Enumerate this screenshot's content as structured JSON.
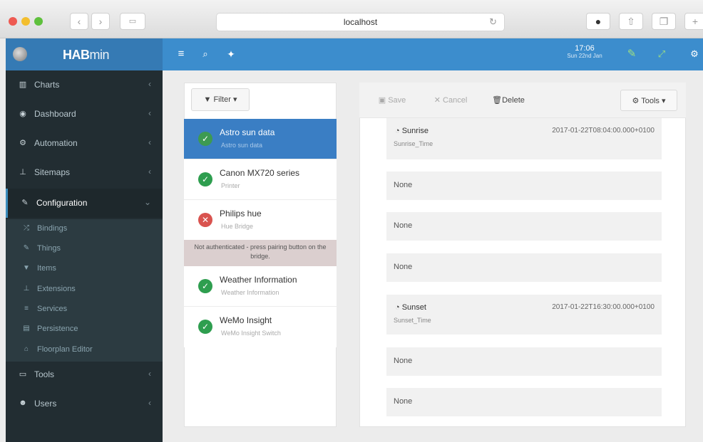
{
  "browser": {
    "url": "localhost"
  },
  "app": {
    "brand_bold": "HAB",
    "brand_light": "min",
    "time": "17:06",
    "date": "Sun 22nd Jan"
  },
  "sidebar": {
    "items": [
      {
        "label": "Charts",
        "icon": "bar-chart-icon"
      },
      {
        "label": "Dashboard",
        "icon": "dashboard-icon"
      },
      {
        "label": "Automation",
        "icon": "cogs-icon"
      },
      {
        "label": "Sitemaps",
        "icon": "sitemap-icon"
      },
      {
        "label": "Configuration",
        "icon": "wrench-icon"
      },
      {
        "label": "Tools",
        "icon": "laptop-icon"
      },
      {
        "label": "Users",
        "icon": "users-icon"
      }
    ],
    "submenu": [
      {
        "label": "Bindings",
        "icon": "random-icon"
      },
      {
        "label": "Things",
        "icon": "plug-icon"
      },
      {
        "label": "Items",
        "icon": "filter-icon"
      },
      {
        "label": "Extensions",
        "icon": "puzzle-icon"
      },
      {
        "label": "Services",
        "icon": "server-icon"
      },
      {
        "label": "Persistence",
        "icon": "database-icon"
      },
      {
        "label": "Floorplan Editor",
        "icon": "home-icon"
      }
    ]
  },
  "things": {
    "filter_label": "Filter",
    "items": [
      {
        "name": "Astro sun data",
        "subtitle": "Astro sun data",
        "status": "online"
      },
      {
        "name": "Canon MX720 series",
        "subtitle": "Printer",
        "status": "online"
      },
      {
        "name": "Philips hue",
        "subtitle": "Hue Bridge",
        "status": "offline"
      },
      {
        "name": "Weather Information",
        "subtitle": "Weather Information",
        "status": "online"
      },
      {
        "name": "WeMo Insight",
        "subtitle": "WeMo Insight Switch",
        "status": "online"
      }
    ],
    "warning": "Not authenticated - press pairing button on the bridge."
  },
  "detail": {
    "toolbar": {
      "save": "Save",
      "cancel": "Cancel",
      "delete": "Delete",
      "tools": "Tools"
    },
    "channels": [
      {
        "name": "Sunrise",
        "sub": "Sunrise_Time",
        "value": "2017-01-22T08:04:00.000+0100"
      },
      {
        "name": "None"
      },
      {
        "name": "None"
      },
      {
        "name": "None"
      },
      {
        "name": "Sunset",
        "sub": "Sunset_Time",
        "value": "2017-01-22T16:30:00.000+0100"
      },
      {
        "name": "None"
      },
      {
        "name": "None"
      }
    ]
  },
  "colors": {
    "header": "#3c8dcd",
    "sidebar": "#222d32",
    "selected": "#3a7ec4",
    "online": "#2e9e4f",
    "offline": "#d9534f"
  }
}
